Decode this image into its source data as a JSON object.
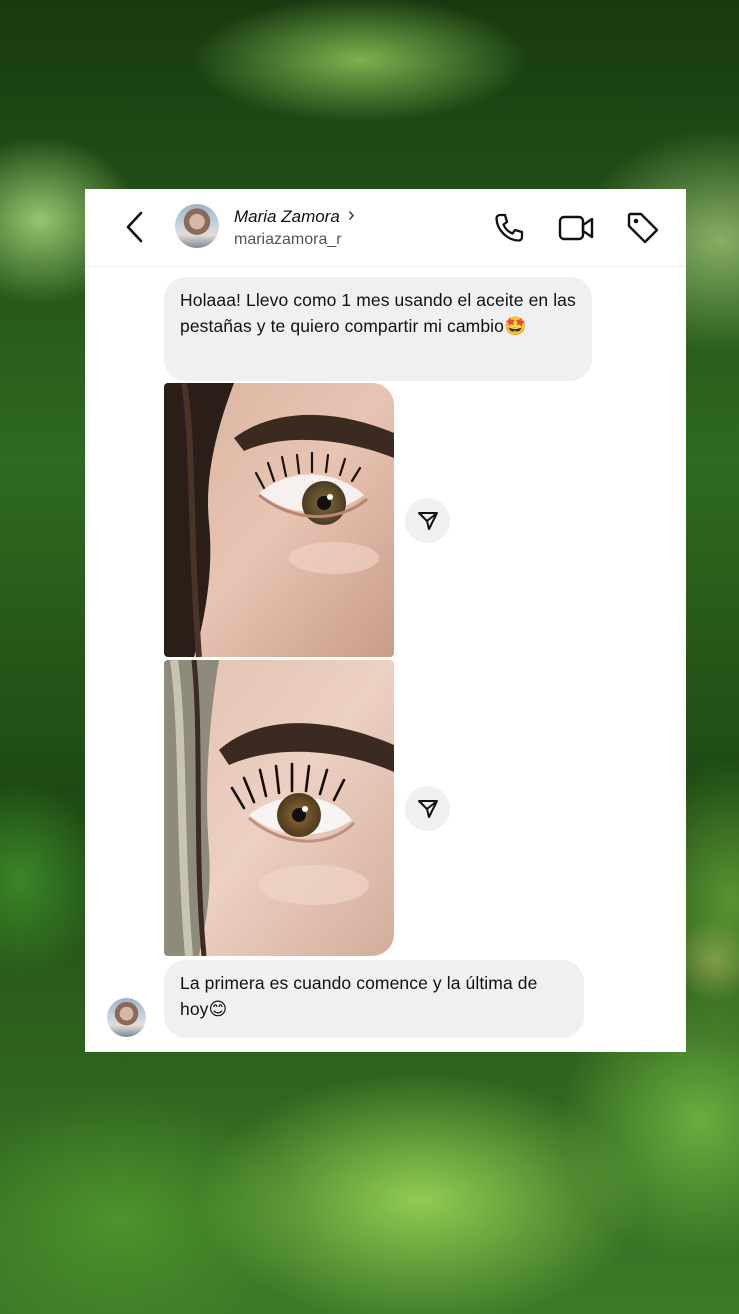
{
  "header": {
    "name": "Maria Zamora",
    "name_chevron": "›",
    "username": "mariazamora_r",
    "icons": [
      "back-arrow-icon",
      "phone-icon",
      "video-camera-icon",
      "tag-icon"
    ]
  },
  "messages": [
    {
      "type": "text",
      "text": "Holaaa! Llevo como 1 mes usando el aceite en las pestañas y te quiero compartir mi cambio",
      "emoji": "🤩"
    },
    {
      "type": "image",
      "description_icon": "share-icon"
    },
    {
      "type": "image",
      "description_icon": "share-icon"
    },
    {
      "type": "text",
      "text": "La primera es cuando comence y la última de hoy",
      "emoji": "😊"
    }
  ],
  "colors": {
    "bubble": "#eff0f2",
    "card": "#ffffff",
    "text": "#111111",
    "muted": "#555555"
  }
}
